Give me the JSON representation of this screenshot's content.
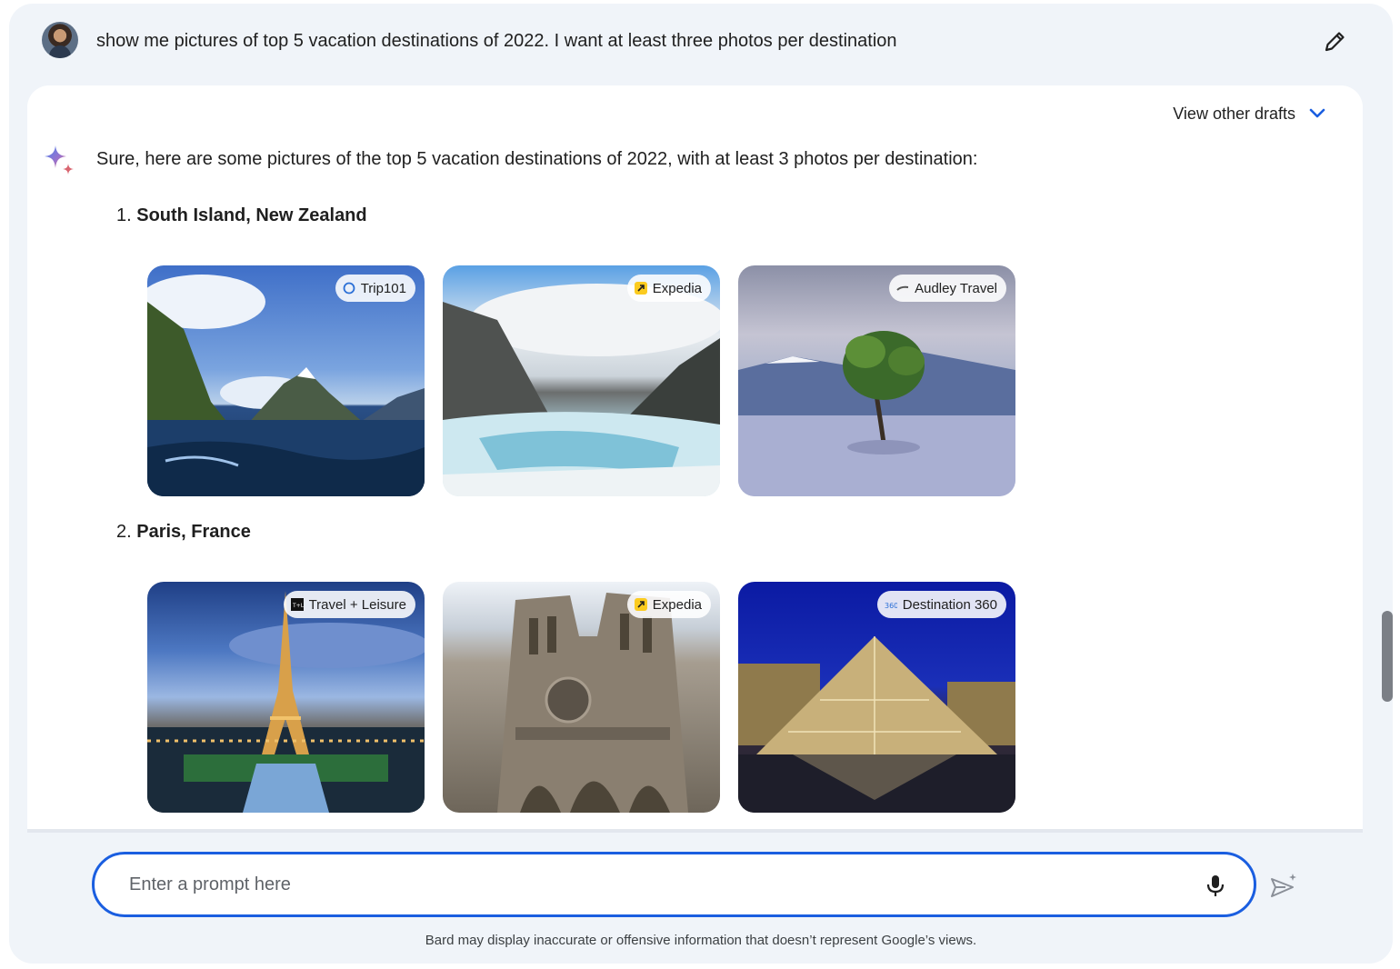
{
  "user_prompt": {
    "text": "show me pictures of top 5 vacation destinations of 2022. I want at least three photos per destination"
  },
  "response": {
    "view_drafts_label": "View other drafts",
    "intro": "Sure, here are some pictures of the top 5 vacation destinations of 2022, with at least 3 photos per destination:",
    "destinations": [
      {
        "number": "1.",
        "name": "South Island, New Zealand",
        "photos": [
          {
            "source": "Trip101",
            "source_icon": "trip101-icon"
          },
          {
            "source": "Expedia",
            "source_icon": "expedia-icon"
          },
          {
            "source": "Audley Travel",
            "source_icon": "audley-icon"
          }
        ]
      },
      {
        "number": "2.",
        "name": "Paris, France",
        "photos": [
          {
            "source": "Travel + Leisure",
            "source_icon": "travel-leisure-icon"
          },
          {
            "source": "Expedia",
            "source_icon": "expedia-icon"
          },
          {
            "source": "Destination 360",
            "source_icon": "destination360-icon"
          }
        ]
      }
    ]
  },
  "input": {
    "placeholder": "Enter a prompt here"
  },
  "disclaimer": "Bard may display inaccurate or offensive information that doesn’t represent Google’s views.",
  "colors": {
    "accent": "#1a5ee0",
    "background": "#f0f4f9"
  }
}
